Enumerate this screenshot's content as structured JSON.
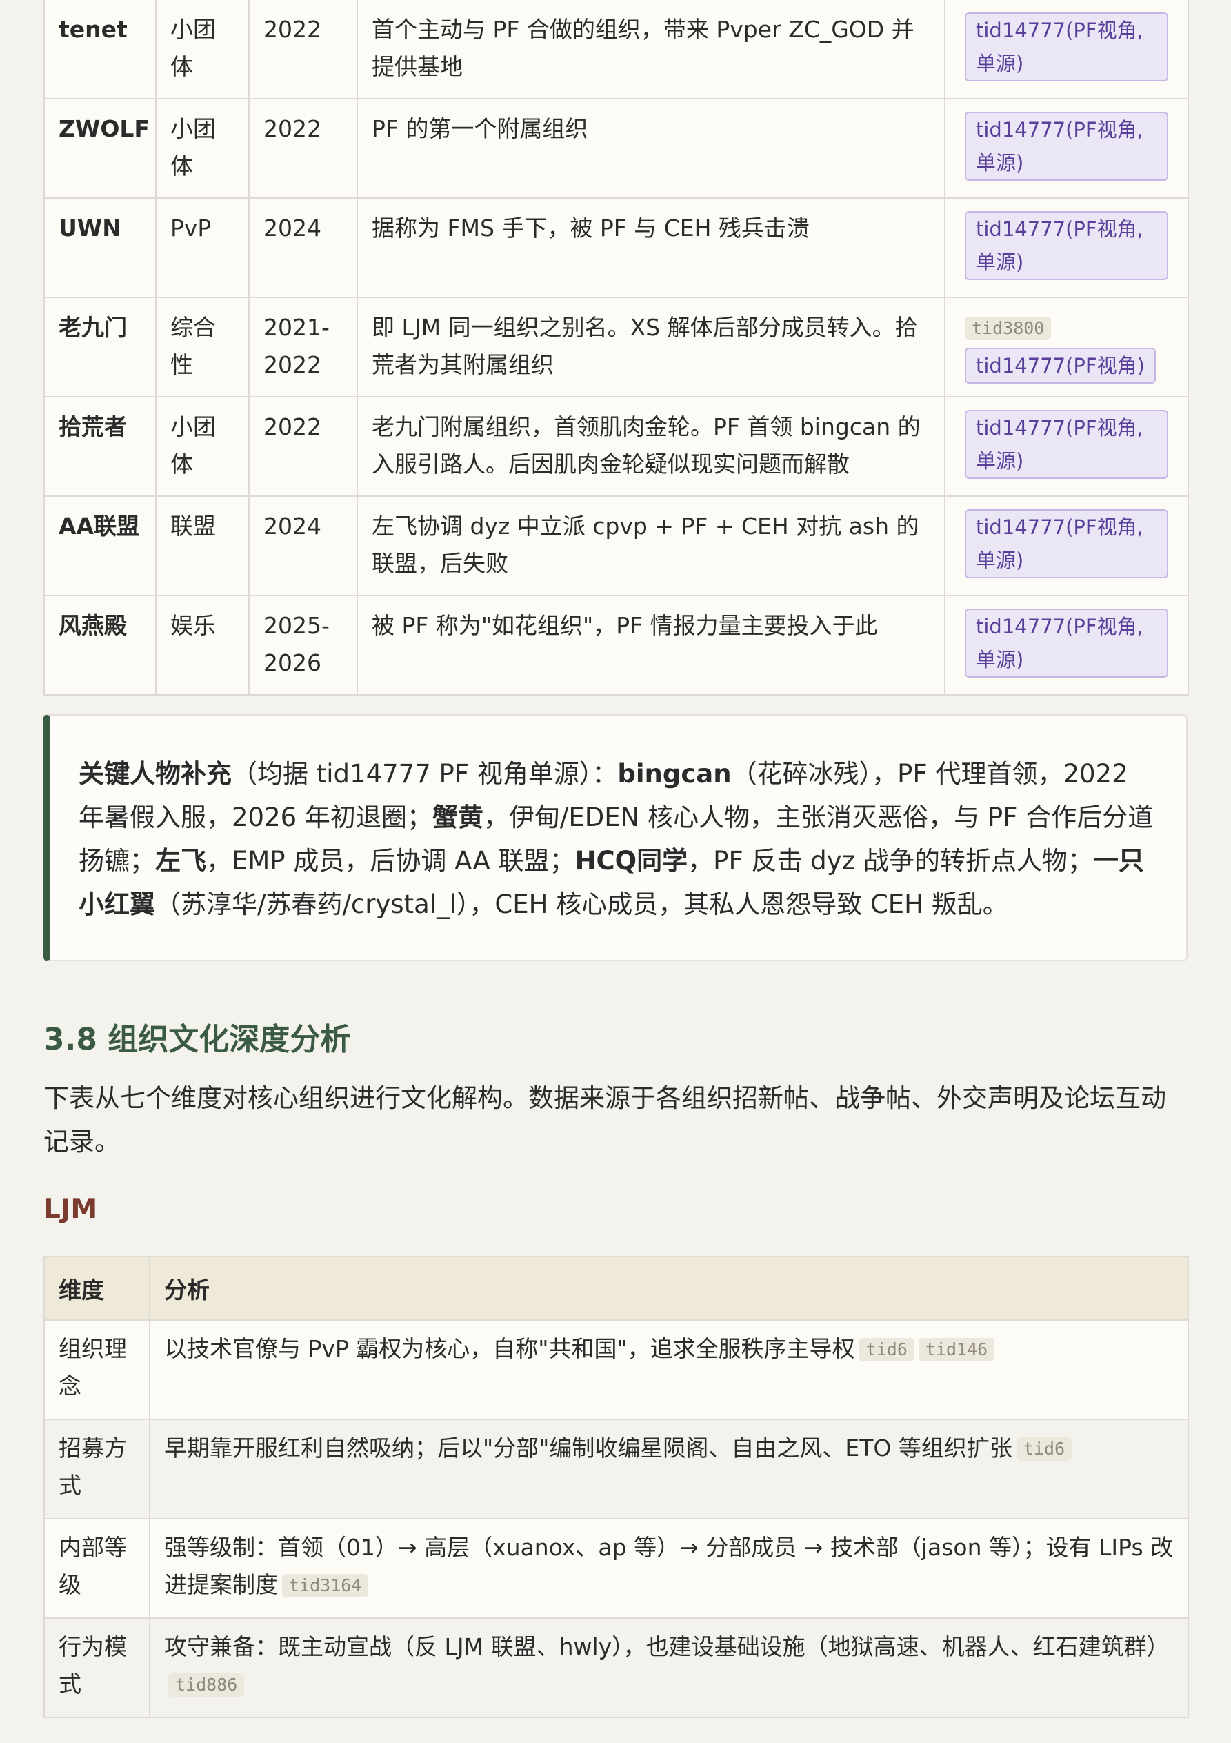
{
  "org_table": {
    "rows": [
      {
        "name": "tenet",
        "type": "小团体",
        "year": "2022",
        "desc": "首个主动与 PF 合做的组织，带来 Pvper ZC_GOD 并提供基地",
        "sources": [
          {
            "kind": "pill",
            "text": "tid14777(PF视角,单源)"
          }
        ]
      },
      {
        "name": "ZWOLF",
        "type": "小团体",
        "year": "2022",
        "desc": "PF 的第一个附属组织",
        "sources": [
          {
            "kind": "pill",
            "text": "tid14777(PF视角,单源)"
          }
        ]
      },
      {
        "name": "UWN",
        "type": "PvP",
        "year": "2024",
        "desc": "据称为 FMS 手下，被 PF 与 CEH 残兵击溃",
        "sources": [
          {
            "kind": "pill",
            "text": "tid14777(PF视角,单源)"
          }
        ]
      },
      {
        "name": "老九门",
        "type": "综合性",
        "year": "2021-2022",
        "desc": "即 LJM 同一组织之别名。XS 解体后部分成员转入。拾荒者为其附属组织",
        "sources": [
          {
            "kind": "chip",
            "text": "tid3800"
          },
          {
            "kind": "pill",
            "text": "tid14777(PF视角)"
          }
        ]
      },
      {
        "name": "拾荒者",
        "type": "小团体",
        "year": "2022",
        "desc": "老九门附属组织，首领肌肉金轮。PF 首领 bingcan 的入服引路人。后因肌肉金轮疑似现实问题而解散",
        "sources": [
          {
            "kind": "pill",
            "text": "tid14777(PF视角,单源)"
          }
        ]
      },
      {
        "name": "AA联盟",
        "type": "联盟",
        "year": "2024",
        "desc": "左飞协调 dyz 中立派 cpvp + PF + CEH 对抗 ash 的联盟，后失败",
        "sources": [
          {
            "kind": "pill",
            "text": "tid14777(PF视角,单源)"
          }
        ]
      },
      {
        "name": "风燕殿",
        "type": "娱乐",
        "year": "2025-2026",
        "desc": "被 PF 称为\"如花组织\"，PF 情报力量主要投入于此",
        "sources": [
          {
            "kind": "pill",
            "text": "tid14777(PF视角,单源)"
          }
        ]
      }
    ]
  },
  "callout": {
    "lead_bold": "关键人物补充",
    "lead_rest": "（均据 tid14777 PF 视角单源）：",
    "p1_bold": "bingcan",
    "p1_rest": "（花碎冰残），PF 代理首领，2022 年暑假入服，2026 年初退圈；",
    "p2_bold": "蟹黄",
    "p2_rest": "，伊甸/EDEN 核心人物，主张消灭恶俗，与 PF 合作后分道扬镳；",
    "p3_bold": "左飞",
    "p3_rest": "，EMP 成员，后协调 AA 联盟；",
    "p4_bold": "HCQ同学",
    "p4_rest": "，PF 反击 dyz 战争的转折点人物；",
    "p5_bold": "一只小红翼",
    "p5_rest": "（苏淳华/苏春药/crystal_l），CEH 核心成员，其私人恩怨导致 CEH 叛乱。"
  },
  "section": {
    "title": "3.8 组织文化深度分析",
    "intro": "下表从七个维度对核心组织进行文化解构。数据来源于各组织招新帖、战争帖、外交声明及论坛互动记录。",
    "subtitle": "LJM"
  },
  "analysis_table": {
    "headers": [
      "维度",
      "分析"
    ],
    "rows": [
      {
        "dim": "组织理念",
        "text": "以技术官僚与 PvP 霸权为核心，自称\"共和国\"，追求全服秩序主导权",
        "chips": [
          "tid6",
          "tid146"
        ]
      },
      {
        "dim": "招募方式",
        "text": "早期靠开服红利自然吸纳；后以\"分部\"编制收编星陨阁、自由之风、ETO 等组织扩张",
        "chips": [
          "tid6"
        ]
      },
      {
        "dim": "内部等级",
        "text": "强等级制：首领（01）→ 高层（xuanox、ap 等）→ 分部成员 → 技术部（jason 等）；设有 LIPs 改进提案制度",
        "chips": [
          "tid3164"
        ]
      },
      {
        "dim": "行为模式",
        "text": "攻守兼备：既主动宣战（反 LJM 联盟、hwly），也建设基础设施（地狱高速、机器人、红石建筑群）",
        "chips": [
          "tid886"
        ]
      }
    ]
  }
}
